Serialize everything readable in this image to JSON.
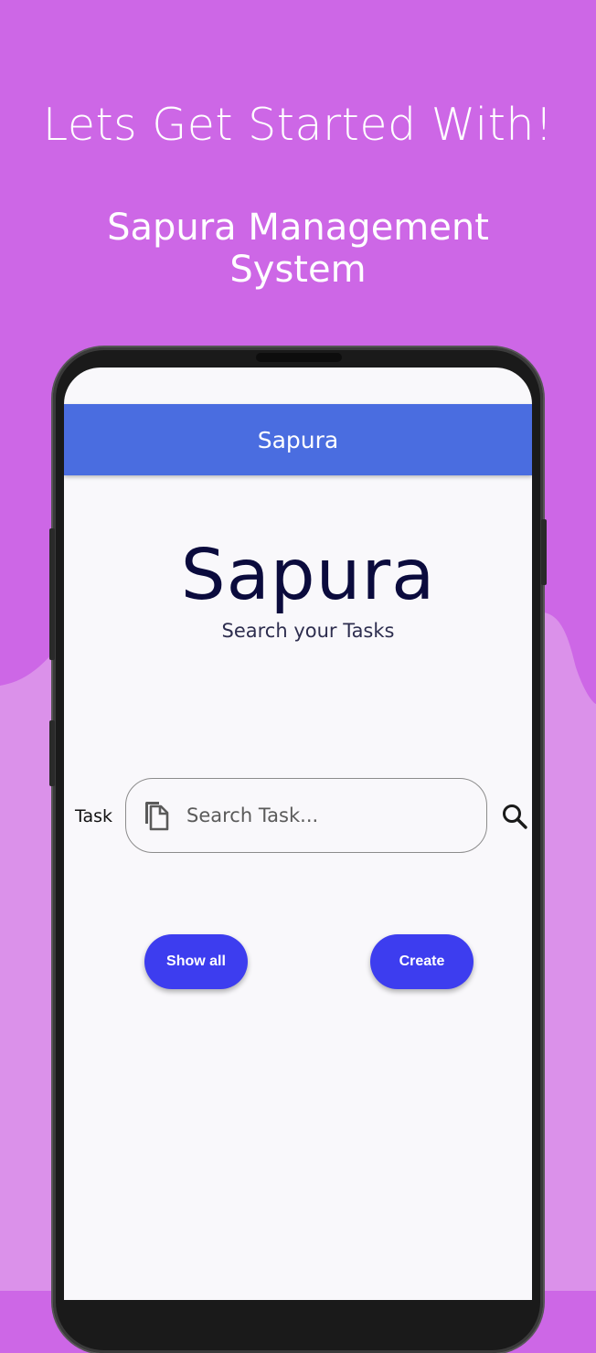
{
  "header": {
    "headline": "Lets Get Started With!",
    "subheadline": "Sapura Management System"
  },
  "app": {
    "appbar_title": "Sapura",
    "logo_text": "Sapura",
    "tagline": "Search your Tasks",
    "task_label": "Task",
    "search_placeholder": "Search Task...",
    "show_all_label": "Show all",
    "create_label": "Create"
  },
  "colors": {
    "background": "#cd67e6",
    "wave": "#db91ea",
    "appbar": "#4a6de0",
    "button": "#3d3def",
    "logo_text": "#0b0b3d"
  },
  "icons": {
    "field_prefix": "copy-icon",
    "search": "search-icon"
  }
}
